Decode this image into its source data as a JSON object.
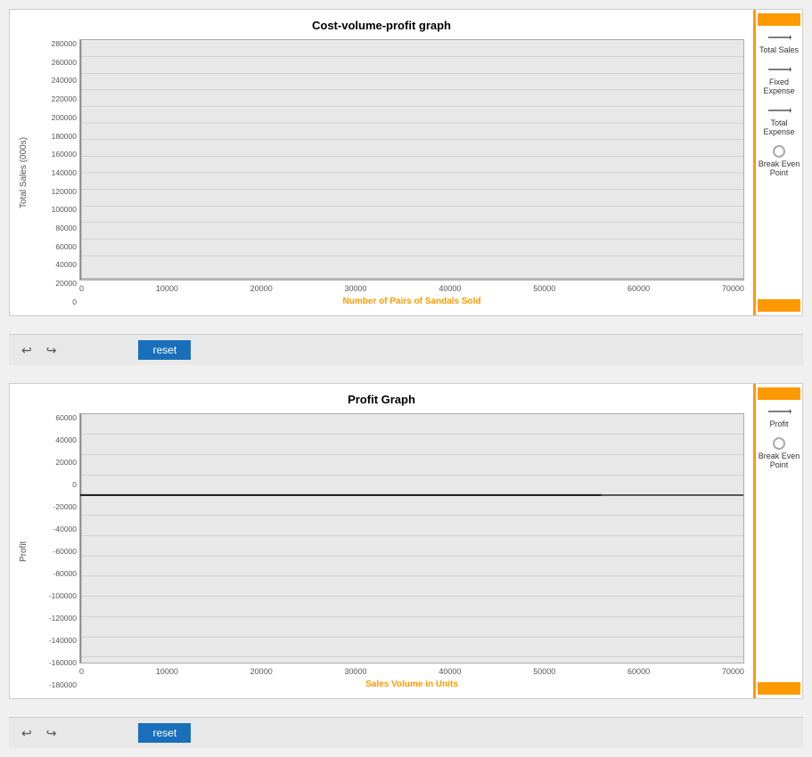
{
  "chart1": {
    "title": "Cost-volume-profit graph",
    "yAxisLabel": "Total Sales (000s)",
    "xAxisLabel": "Number of Pairs of Sandals Sold",
    "yTicks": [
      "280000",
      "260000",
      "240000",
      "220000",
      "200000",
      "180000",
      "160000",
      "140000",
      "120000",
      "100000",
      "80000",
      "60000",
      "40000",
      "20000",
      "0"
    ],
    "xTicks": [
      "0",
      "10000",
      "20000",
      "30000",
      "40000",
      "50000",
      "60000",
      "70000"
    ],
    "legend": {
      "items": [
        {
          "type": "line",
          "label": "Total Sales"
        },
        {
          "type": "line",
          "label": "Fixed\nExpense"
        },
        {
          "type": "line",
          "label": "Total\nExpense"
        },
        {
          "type": "circle",
          "label": "Break Even\nPoint"
        }
      ]
    },
    "controls": {
      "resetLabel": "reset"
    }
  },
  "chart2": {
    "title": "Profit Graph",
    "yAxisLabel": "Profit",
    "xAxisLabel": "Sales Volume in Units",
    "yTicks": [
      "60000",
      "40000",
      "20000",
      "0",
      "-20000",
      "-40000",
      "-60000",
      "-80000",
      "-100000",
      "-120000",
      "-140000",
      "-160000",
      "-180000"
    ],
    "xTicks": [
      "0",
      "10000",
      "20000",
      "30000",
      "40000",
      "50000",
      "60000",
      "70000"
    ],
    "legend": {
      "items": [
        {
          "type": "line",
          "label": "Profit"
        },
        {
          "type": "circle",
          "label": "Break Even\nPoint"
        }
      ]
    },
    "controls": {
      "resetLabel": "reset"
    }
  }
}
